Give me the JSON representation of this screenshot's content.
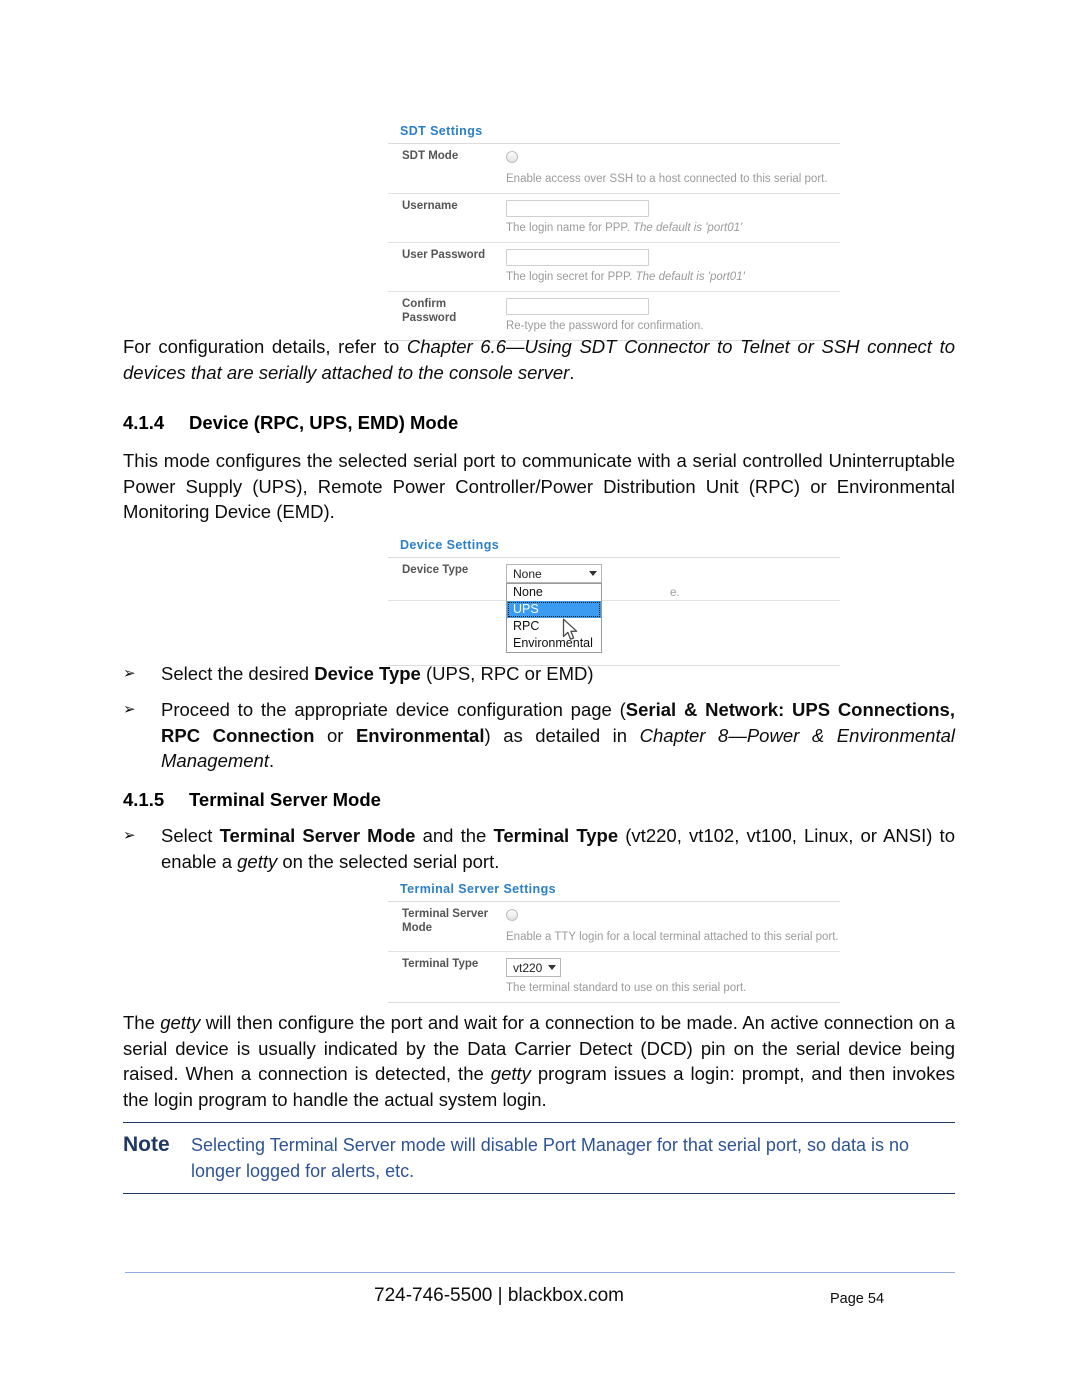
{
  "document": {
    "page_label": "Page 54",
    "footer_contact": "724-746-5500 | blackbox.com"
  },
  "intro_paragraph": {
    "lead": "For configuration details, refer to ",
    "italic_ref": "Chapter 6.6—Using SDT Connector to Telnet or SSH connect to devices that are serially attached to the console server",
    "tail": "."
  },
  "section_414": {
    "number": "4.1.4",
    "title": "Device (RPC, UPS, EMD) Mode",
    "paragraph": "This mode configures the selected serial port to communicate with a serial controlled Uninterruptable Power Supply (UPS), Remote Power Controller/Power Distribution Unit (RPC) or Environmental Monitoring Device (EMD)."
  },
  "section_415": {
    "number": "4.1.5",
    "title": "Terminal Server Mode"
  },
  "bullets": {
    "device_type": {
      "marker": "➢",
      "p1": "Select the desired ",
      "b1": "Device Type",
      "p2": " (UPS, RPC or EMD)"
    },
    "proceed": {
      "marker": "➢",
      "p1": "Proceed to the appropriate device configuration page (",
      "b1": "Serial & Network: UPS Connections, RPC Connection",
      "p2": " or ",
      "b2": "Environmental",
      "p3": ") as detailed in ",
      "i1": "Chapter 8—Power & Environmental Management",
      "p4": "."
    },
    "terminal": {
      "marker": "➢",
      "p1": "Select ",
      "b1": "Terminal Server Mode",
      "p2": " and the ",
      "b2": "Terminal Type",
      "p3": " (vt220, vt102, vt100, Linux, or ANSI) to enable a ",
      "i1": "getty",
      "p4": " on the selected serial port."
    }
  },
  "getty_paragraph": {
    "p1": "The ",
    "i1": "getty",
    "p2": " will then configure the port and wait for a connection to be made. An active connection on a serial device is usually indicated by the Data Carrier Detect (DCD) pin on the serial device being raised. When a connection is detected, the ",
    "i2": "getty",
    "p3": " program issues a login: prompt, and then invokes the login program to handle the actual system login."
  },
  "note": {
    "label": "Note",
    "text": "Selecting Terminal Server mode will disable Port Manager for that serial port, so data is no longer logged for alerts, etc.",
    "accent_color": "#1F3864",
    "text_color": "#2E5496"
  },
  "sdt_settings": {
    "panel_title": "SDT Settings",
    "rows": [
      {
        "label": "SDT Mode",
        "control": "radio",
        "help": "Enable access over SSH to a host connected to this serial port."
      },
      {
        "label": "Username",
        "control": "text",
        "value": "",
        "help_plain": "The login name for PPP. ",
        "help_italic": "The default is 'port01'"
      },
      {
        "label": "User Password",
        "control": "text",
        "value": "",
        "help_plain": "The login secret for PPP. ",
        "help_italic": "The default is 'port01'"
      },
      {
        "label": "Confirm Password",
        "control": "text",
        "value": "",
        "help": "Re-type the password for confirmation."
      }
    ]
  },
  "device_settings": {
    "panel_title": "Device Settings",
    "row_label": "Device Type",
    "selected_value": "None",
    "options": [
      "None",
      "UPS",
      "RPC",
      "Environmental"
    ],
    "highlighted_option": "UPS",
    "help_fragment": "e.",
    "highlight_color": "#3B9BF0"
  },
  "terminal_server_settings": {
    "panel_title": "Terminal Server Settings",
    "rows": [
      {
        "label": "Terminal Server Mode",
        "control": "radio",
        "help": "Enable a TTY login for a local terminal attached to this serial port."
      },
      {
        "label": "Terminal Type",
        "control": "select",
        "value": "vt220",
        "help": "The terminal standard to use on this serial port."
      }
    ]
  }
}
